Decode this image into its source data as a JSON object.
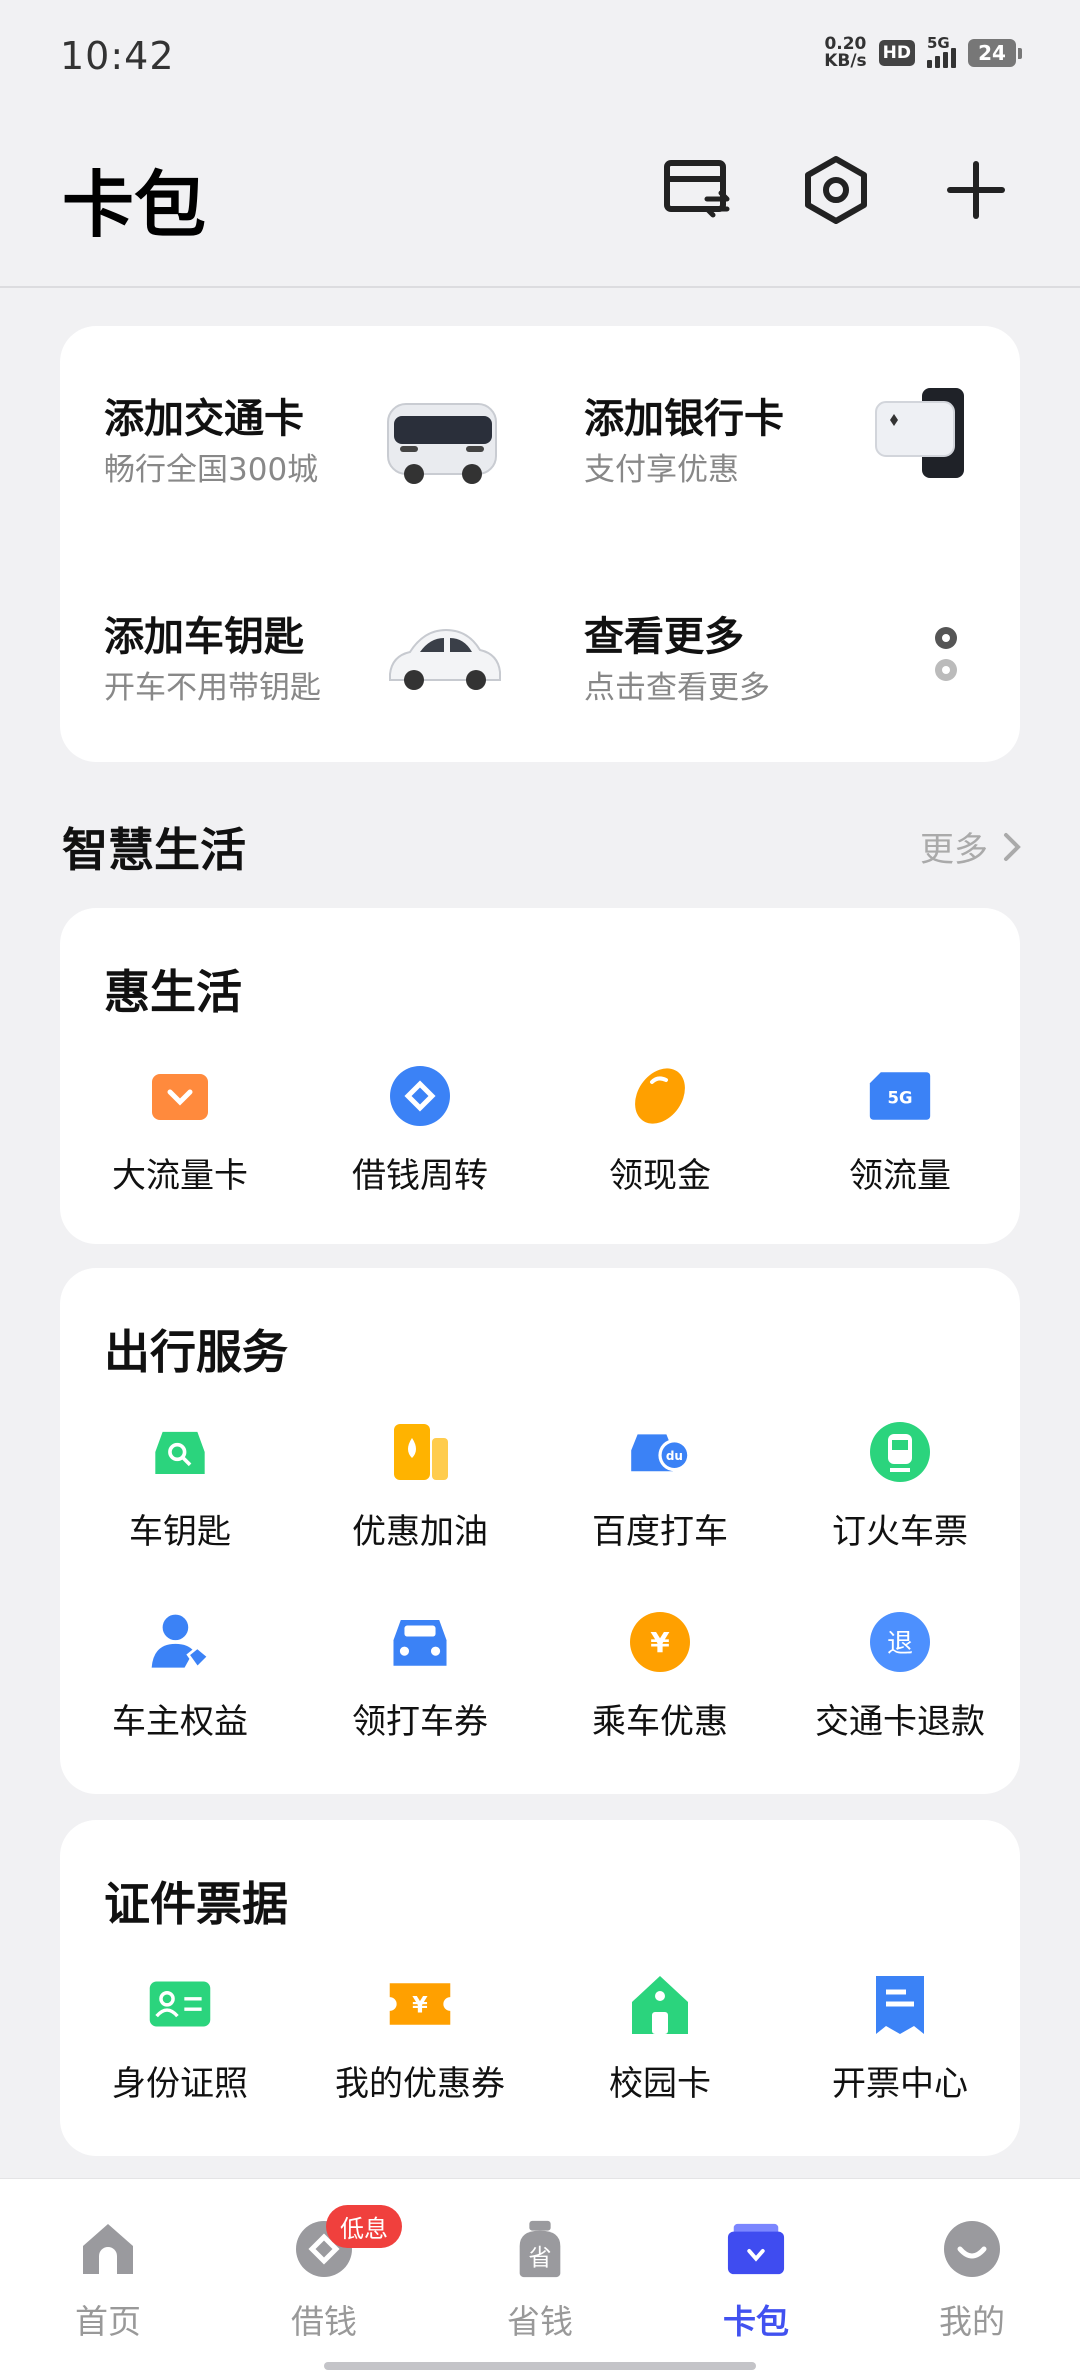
{
  "status": {
    "time": "10:42",
    "speed_value": "0.20",
    "speed_unit": "KB/s",
    "hd": "HD",
    "network": "5G",
    "battery": "24"
  },
  "header": {
    "title": "卡包",
    "icons": [
      "card-swap-icon",
      "settings-hexagon-icon",
      "plus-icon"
    ]
  },
  "quick_actions": [
    {
      "title": "添加交通卡",
      "subtitle": "畅行全国300城",
      "icon": "bus-icon"
    },
    {
      "title": "添加银行卡",
      "subtitle": "支付享优惠",
      "icon": "bank-card-phone-icon"
    },
    {
      "title": "添加车钥匙",
      "subtitle": "开车不用带钥匙",
      "icon": "car-icon"
    },
    {
      "title": "查看更多",
      "subtitle": "点击查看更多",
      "icon": "more-dots-icon"
    }
  ],
  "smart_life": {
    "title": "智慧生活",
    "more": "更多"
  },
  "hui_life": {
    "title": "惠生活",
    "items": [
      {
        "label": "大流量卡",
        "icon": "data-card-icon",
        "color": "#ff8a3d"
      },
      {
        "label": "借钱周转",
        "icon": "loan-icon",
        "color": "#3b82f6"
      },
      {
        "label": "领现金",
        "icon": "bean-icon",
        "color": "#ffa000"
      },
      {
        "label": "领流量",
        "icon": "sim-5g-icon",
        "color": "#3b82f6"
      }
    ]
  },
  "travel": {
    "title": "出行服务",
    "items": [
      {
        "label": "车钥匙",
        "icon": "car-key-icon",
        "color": "#2bd47d"
      },
      {
        "label": "优惠加油",
        "icon": "fuel-icon",
        "color": "#ffb300"
      },
      {
        "label": "百度打车",
        "icon": "baidu-taxi-icon",
        "color": "#3b82f6"
      },
      {
        "label": "订火车票",
        "icon": "train-icon",
        "color": "#2bd47d"
      },
      {
        "label": "车主权益",
        "icon": "owner-benefit-icon",
        "color": "#3b82f6"
      },
      {
        "label": "领打车券",
        "icon": "taxi-coupon-icon",
        "color": "#3b82f6"
      },
      {
        "label": "乘车优惠",
        "icon": "yuan-coin-icon",
        "color": "#ffa000"
      },
      {
        "label": "交通卡退款",
        "icon": "refund-icon",
        "color": "#4d90fe"
      }
    ],
    "yuan_glyph": "¥",
    "refund_glyph": "退",
    "du_glyph": "du"
  },
  "documents": {
    "title": "证件票据",
    "items": [
      {
        "label": "身份证照",
        "icon": "id-card-icon",
        "color": "#2bd47d"
      },
      {
        "label": "我的优惠券",
        "icon": "coupon-icon",
        "color": "#ffa000"
      },
      {
        "label": "校园卡",
        "icon": "campus-icon",
        "color": "#2bd47d"
      },
      {
        "label": "开票中心",
        "icon": "invoice-icon",
        "color": "#3b82f6"
      }
    ],
    "coupon_glyph": "¥"
  },
  "tabs": [
    {
      "label": "首页",
      "icon": "home-icon",
      "active": false
    },
    {
      "label": "借钱",
      "icon": "borrow-icon",
      "active": false,
      "badge": "低息"
    },
    {
      "label": "省钱",
      "icon": "save-money-icon",
      "active": false,
      "glyph": "省"
    },
    {
      "label": "卡包",
      "icon": "wallet-icon",
      "active": true
    },
    {
      "label": "我的",
      "icon": "profile-icon",
      "active": false
    }
  ]
}
